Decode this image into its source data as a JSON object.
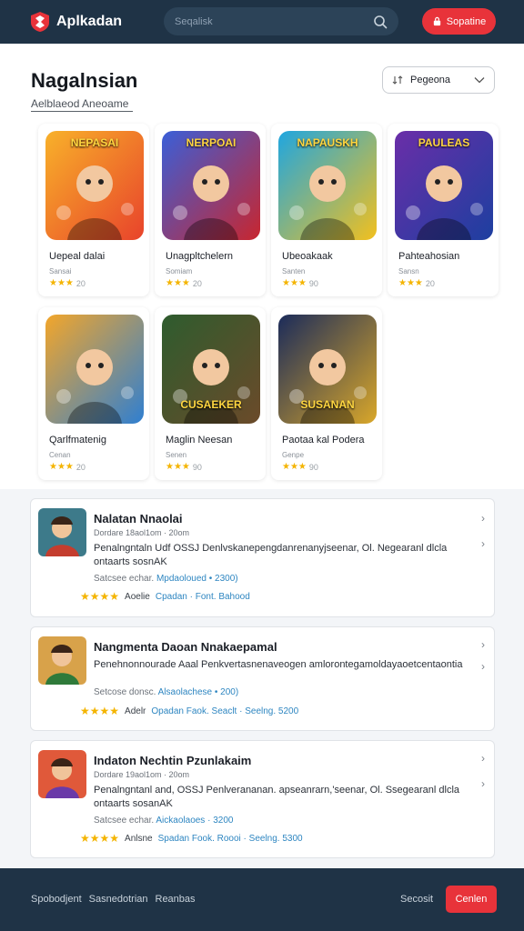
{
  "app": {
    "name": "Aplkadan",
    "logo_icon": "shield-logo-icon"
  },
  "header": {
    "search_placeholder": "Seqalisk",
    "signin_label": "Sopatine"
  },
  "page": {
    "title": "Nagalnsian",
    "subtitle": "Aelblaeod Aneoame",
    "sort_icon": "sort-icon",
    "sort_value": "Pegeona"
  },
  "games": [
    {
      "name": "Uepeal dalai",
      "meta": "Sansai",
      "rating": "20",
      "art_text": "NEPASAI",
      "colors": [
        "#f8b12a",
        "#e8432b"
      ]
    },
    {
      "name": "Unagpltchelern",
      "meta": "Somiam",
      "rating": "20",
      "art_text": "NERPOAI",
      "colors": [
        "#3a5fd8",
        "#c8262f"
      ]
    },
    {
      "name": "Ubeoakaak",
      "meta": "Santen",
      "rating": "90",
      "art_text": "NAPAUSKH",
      "colors": [
        "#1fa6e0",
        "#f2c01e"
      ]
    },
    {
      "name": "Pahteahosian",
      "meta": "Sansn",
      "rating": "20",
      "art_text": "PAULEAS",
      "colors": [
        "#6a2ea8",
        "#1d3fa0"
      ]
    },
    {
      "name": "Qarlfmatenig",
      "meta": "Cenan",
      "rating": "20",
      "art_text": "",
      "colors": [
        "#f3a62a",
        "#2f7fd1"
      ]
    },
    {
      "name": "Maglin Neesan",
      "meta": "Senen",
      "rating": "90",
      "art_text": "CUSAEKER",
      "colors": [
        "#2e5c2e",
        "#6b4a2a"
      ]
    },
    {
      "name": "Paotaa kal Podera",
      "meta": "Genpe",
      "rating": "90",
      "art_text": "SUSANAN",
      "colors": [
        "#1b2b5a",
        "#d9a72a"
      ]
    }
  ],
  "articles": [
    {
      "title": "Nalatan Nnaolai",
      "date": "Dordare 18aol1om · 20om",
      "desc": "Penalngntaln Udf OSSJ Denlvskanepengdanrenanyjseenar, Ol. Negearanl dlcla ontaarts sosnAK",
      "source_prefix": "Satcsee echar.",
      "source_link": "Mpdaoloued • 2300)",
      "foot_text": "Aoelie",
      "foot_tags": "Cpadan · Font. Bahood",
      "thumb_colors": [
        "#c43d2e",
        "#3d7a8a"
      ]
    },
    {
      "title": "Nangmenta Daoan Nnakaepamal",
      "date": "",
      "desc": "Penehnonnourade Aaal Penkvertasnenaveogen amlorontegamoldayaoetcentaontia",
      "source_prefix": "Setcose donsc.",
      "source_link": "Alsaolachese • 200)",
      "foot_text": "Adelr",
      "foot_tags": "Opadan Faok. Seaclt · Seelng. 5200",
      "thumb_colors": [
        "#2f7a3a",
        "#d8a24a"
      ]
    },
    {
      "title": "Indaton Nechtin Pzunlakaim",
      "date": "Dordare 19aol1om · 20om",
      "desc": "Penalngntanl and, OSSJ Penlverananan. apseanrarn,'seenar, Ol. Ssegearanl dlcla ontaarts sosanAK",
      "source_prefix": "Satcsee echar.",
      "source_link": "Aickaolaoes · 3200",
      "foot_text": "Anlsne",
      "foot_tags": "Spadan Fook. Roooi · Seelng. 5300",
      "thumb_colors": [
        "#6a3aa8",
        "#e0593a"
      ]
    }
  ],
  "footer": {
    "links": [
      "Spobodjent",
      "Sasnedotrian",
      "Reanbas"
    ],
    "search_label": "Secosit",
    "cta_label": "Cenlen"
  },
  "colors": {
    "header_bg": "#1f3346",
    "accent_red": "#e8333a",
    "star": "#f4b400",
    "link_blue": "#2e86c1"
  }
}
